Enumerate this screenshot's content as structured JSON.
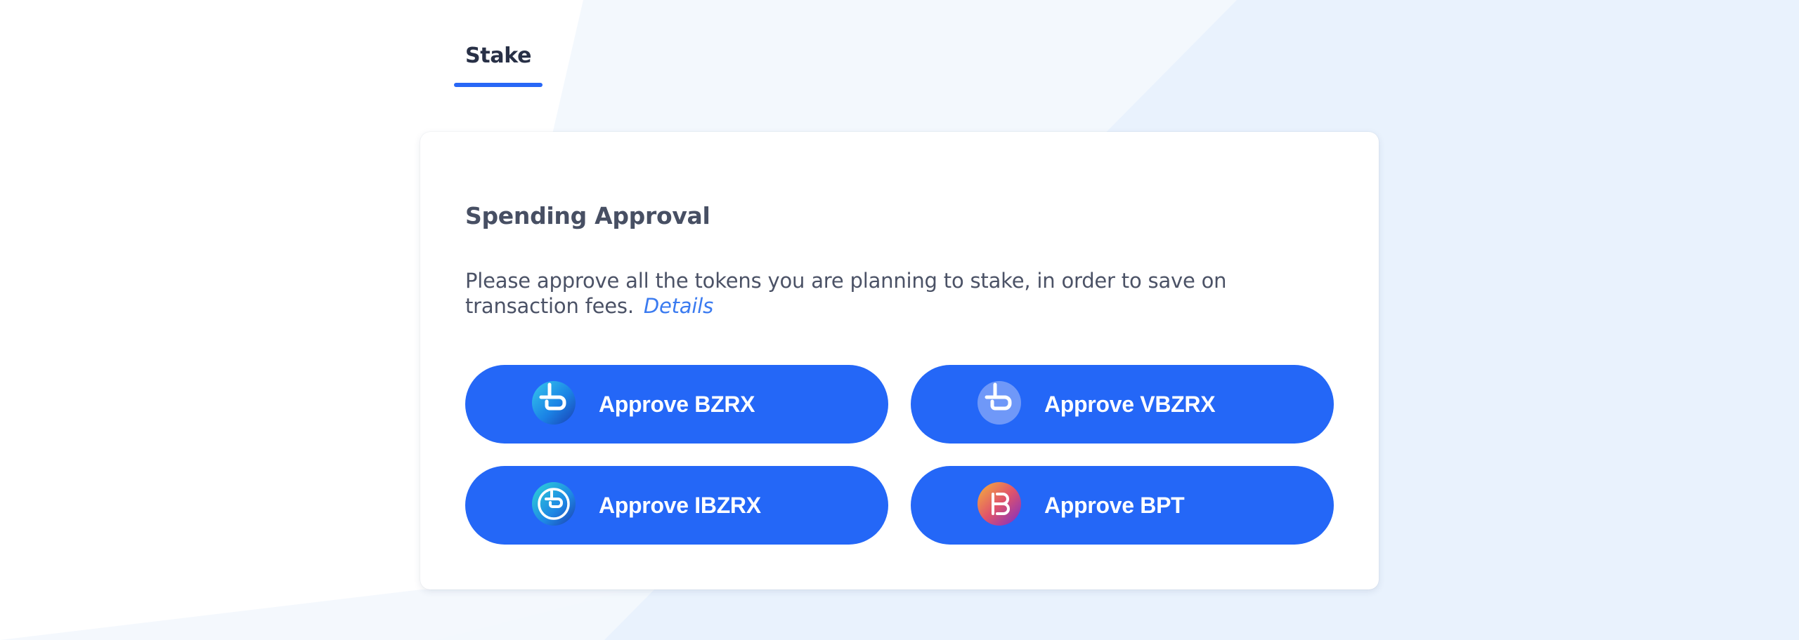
{
  "tabs": [
    {
      "label": "Stake",
      "active": true
    }
  ],
  "card": {
    "title": "Spending Approval",
    "description": "Please approve all the tokens you are planning to stake, in order to save on transaction fees.",
    "details_link": "Details"
  },
  "buttons": [
    {
      "label": "Approve BZRX",
      "icon": "bzrx-token-icon"
    },
    {
      "label": "Approve VBZRX",
      "icon": "vbzrx-token-icon"
    },
    {
      "label": "Approve IBZRX",
      "icon": "ibzrx-token-icon"
    },
    {
      "label": "Approve BPT",
      "icon": "bpt-token-icon"
    }
  ],
  "colors": {
    "accent": "#2467f7",
    "tab_underline": "#2867f6",
    "link": "#3b7bf0",
    "title": "#474f63",
    "text": "#4b5266",
    "background_tint": "#eaf3fd"
  }
}
